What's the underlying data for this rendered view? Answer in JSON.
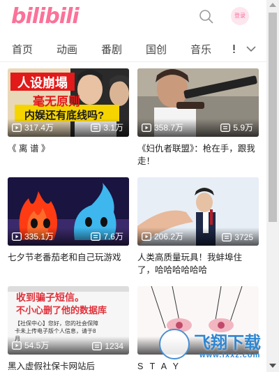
{
  "header": {
    "logo_text": "bilibili",
    "login_label": "登录"
  },
  "nav": {
    "tabs": [
      "首页",
      "动画",
      "番剧",
      "国创",
      "音乐"
    ]
  },
  "cards": [
    {
      "title": "《 离 谱 》",
      "play_count": "317.4万",
      "danmaku_count": "3.1万",
      "thumb_text_1": "人设崩塌",
      "thumb_text_2": "毫无原则",
      "thumb_text_3": "内娱还有底线吗?"
    },
    {
      "title": "《妇仇者联盟》：枪在手，跟我走！",
      "play_count": "358.7万",
      "danmaku_count": "5.9万"
    },
    {
      "title": "七夕节老番茄老和自己玩游戏",
      "play_count": "335.1万",
      "danmaku_count": "7.6万"
    },
    {
      "title": "人类高质量玩具！我蚌埠住了，哈哈哈哈哈哈",
      "play_count": "206.2万",
      "danmaku_count": "3725"
    },
    {
      "title": "黑入虚假社保卡网站后",
      "play_count": "54.5万",
      "danmaku_count": "1234",
      "thumb_text_1": "收到骗子短信。",
      "thumb_text_2": "不小心删了他的数据库",
      "thumb_text_3": "【社保中心】您好，您的社会保障卡未上传电子版个人信息，请于8月"
    },
    {
      "title": "S T A Y",
      "play_count": "",
      "danmaku_count": ""
    }
  ],
  "watermark": {
    "text": "飞翔下载",
    "domain": "www.fxxz.com"
  },
  "colors": {
    "brand_pink": "#fb7299",
    "watermark_blue": "#2f86d1"
  }
}
